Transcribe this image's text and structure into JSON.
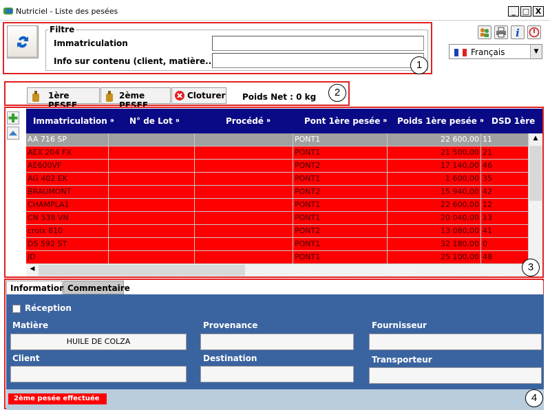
{
  "window": {
    "title": "Nutriciel - Liste des pesées",
    "minimize": "_",
    "maximize": "□",
    "close": "X"
  },
  "filter": {
    "legend": "Filtre",
    "immatriculation_label": "Immatriculation",
    "info_label": "Info sur contenu (client, matière...)",
    "immatriculation_value": "",
    "info_value": ""
  },
  "language": {
    "selected": "Français"
  },
  "pesee_toolbar": {
    "first_label": "1ère PESEE",
    "second_label": "2ème PESEE",
    "close_label": "Cloturer",
    "poids_net": "Poids Net : 0 kg"
  },
  "grid": {
    "columns": [
      "Immatriculation",
      "N° de Lot",
      "Procédé",
      "Pont 1ère pesée",
      "Poids 1ère pesée",
      "DSD 1ère"
    ],
    "rows": [
      {
        "immat": "AA 716 SP",
        "lot": "",
        "procede": "",
        "pont": "PONT1",
        "poids": "22 600,00",
        "dsd": "11",
        "selected": true
      },
      {
        "immat": "AEX 204 FX",
        "lot": "",
        "procede": "",
        "pont": "PONT1",
        "poids": "21 500,00",
        "dsd": "21"
      },
      {
        "immat": "AE600VF",
        "lot": "",
        "procede": "",
        "pont": "PONT2",
        "poids": "17 140,00",
        "dsd": "46"
      },
      {
        "immat": "AG 402 EK",
        "lot": "",
        "procede": "",
        "pont": "PONT1",
        "poids": "1 600,00",
        "dsd": "35"
      },
      {
        "immat": "BRAUMONT",
        "lot": "",
        "procede": "",
        "pont": "PONT2",
        "poids": "15 940,00",
        "dsd": "42"
      },
      {
        "immat": "CHAMPLA1",
        "lot": "",
        "procede": "",
        "pont": "PONT1",
        "poids": "22 600,00",
        "dsd": "12"
      },
      {
        "immat": "CN 538 VN",
        "lot": "",
        "procede": "",
        "pont": "PONT1",
        "poids": "20 040,00",
        "dsd": "13"
      },
      {
        "immat": "croix 810",
        "lot": "",
        "procede": "",
        "pont": "PONT2",
        "poids": "13 080,00",
        "dsd": "41"
      },
      {
        "immat": "DS 592 ST",
        "lot": "",
        "procede": "",
        "pont": "PONT1",
        "poids": "32 180,00",
        "dsd": "0"
      },
      {
        "immat": "JD",
        "lot": "",
        "procede": "",
        "pont": "PONT1",
        "poids": "25 100,00",
        "dsd": "48"
      }
    ]
  },
  "details": {
    "tab_information": "Information",
    "tab_commentaire": "Commentaire",
    "reception_label": "Réception",
    "matiere_label": "Matière",
    "matiere_value": "HUILE DE COLZA",
    "provenance_label": "Provenance",
    "provenance_value": "",
    "fournisseur_label": "Fournisseur",
    "fournisseur_value": "",
    "client_label": "Client",
    "client_value": "",
    "destination_label": "Destination",
    "destination_value": "",
    "transporteur_label": "Transporteur",
    "transporteur_value": "",
    "status": "2ème pesée effectuée"
  },
  "annotations": [
    "1",
    "2",
    "3",
    "4"
  ],
  "colors": {
    "header_bg": "#0a0a86",
    "row_red": "#ff0000",
    "row_selected": "#a0a0a0",
    "panel_bg": "#3a64a0",
    "annotation_red": "#e02020"
  },
  "icons": {
    "refresh": "refresh-icon",
    "weight": "weight-icon",
    "cancel": "cancel-circle-icon",
    "add": "plus-icon",
    "up": "arrow-up-icon",
    "tools": [
      "users-icon",
      "printer-icon",
      "info-icon",
      "power-icon"
    ],
    "flag": "france-flag-icon"
  }
}
